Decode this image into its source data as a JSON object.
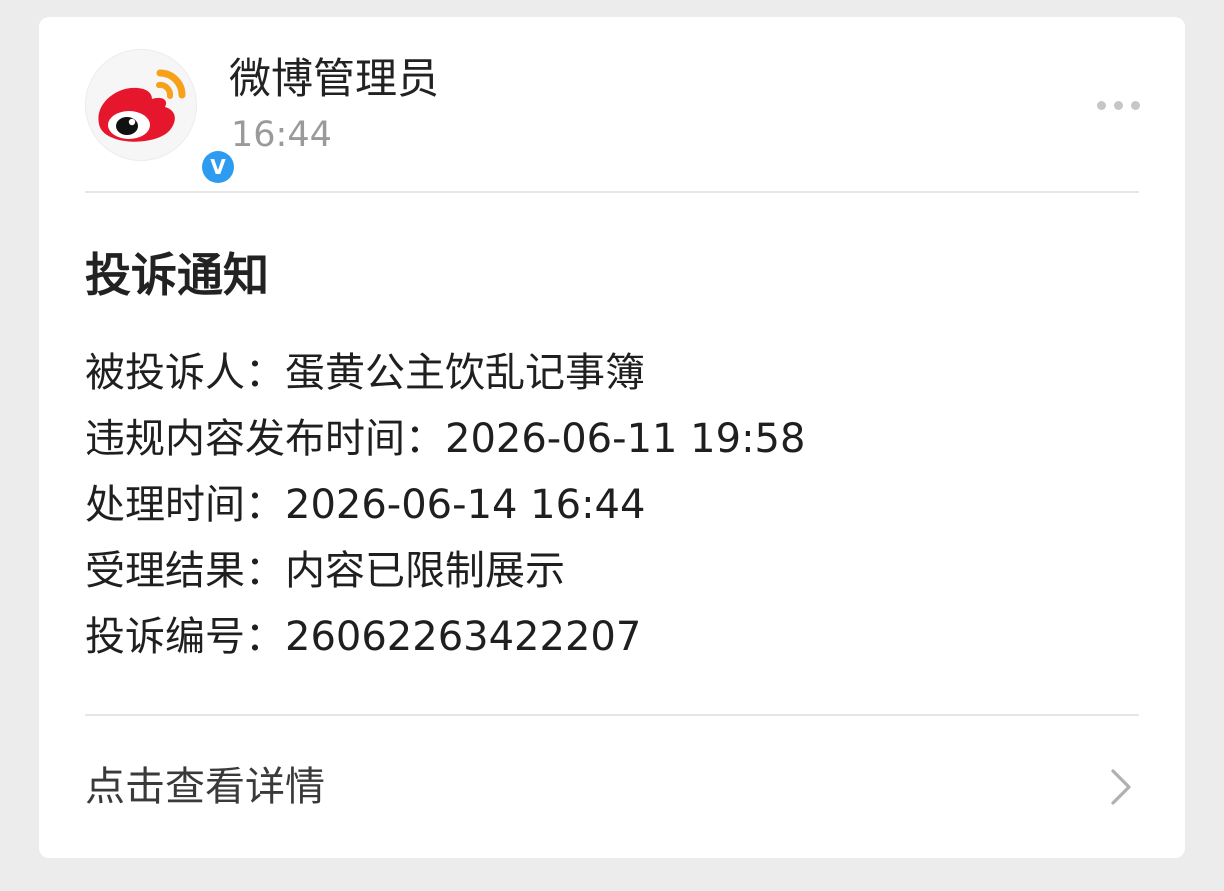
{
  "sender": {
    "name": "微博管理员",
    "time": "16:44",
    "avatar_icon": "weibo-logo-icon",
    "verified_badge": "V",
    "verified_color": "#2d9cf0"
  },
  "menu_icon": "more-icon",
  "notice": {
    "title": "投诉通知",
    "rows": [
      {
        "label": "被投诉人：",
        "value": "蛋黄公主饮乱记事簿"
      },
      {
        "label": "违规内容发布时间：",
        "value": "2026-06-11 19:58"
      },
      {
        "label": "处理时间：",
        "value": "2026-06-14 16:44"
      },
      {
        "label": "受理结果：",
        "value": "内容已限制展示"
      },
      {
        "label": "投诉编号：",
        "value": "26062263422207"
      }
    ]
  },
  "footer": {
    "detail_label": "点击查看详情",
    "arrow_icon": "chevron-right-icon"
  },
  "colors": {
    "page_background": "#ececec",
    "card_background": "#ffffff",
    "weibo_red": "#e6162d",
    "weibo_orange": "#f7a11a",
    "muted_text": "#9a9a9a"
  }
}
